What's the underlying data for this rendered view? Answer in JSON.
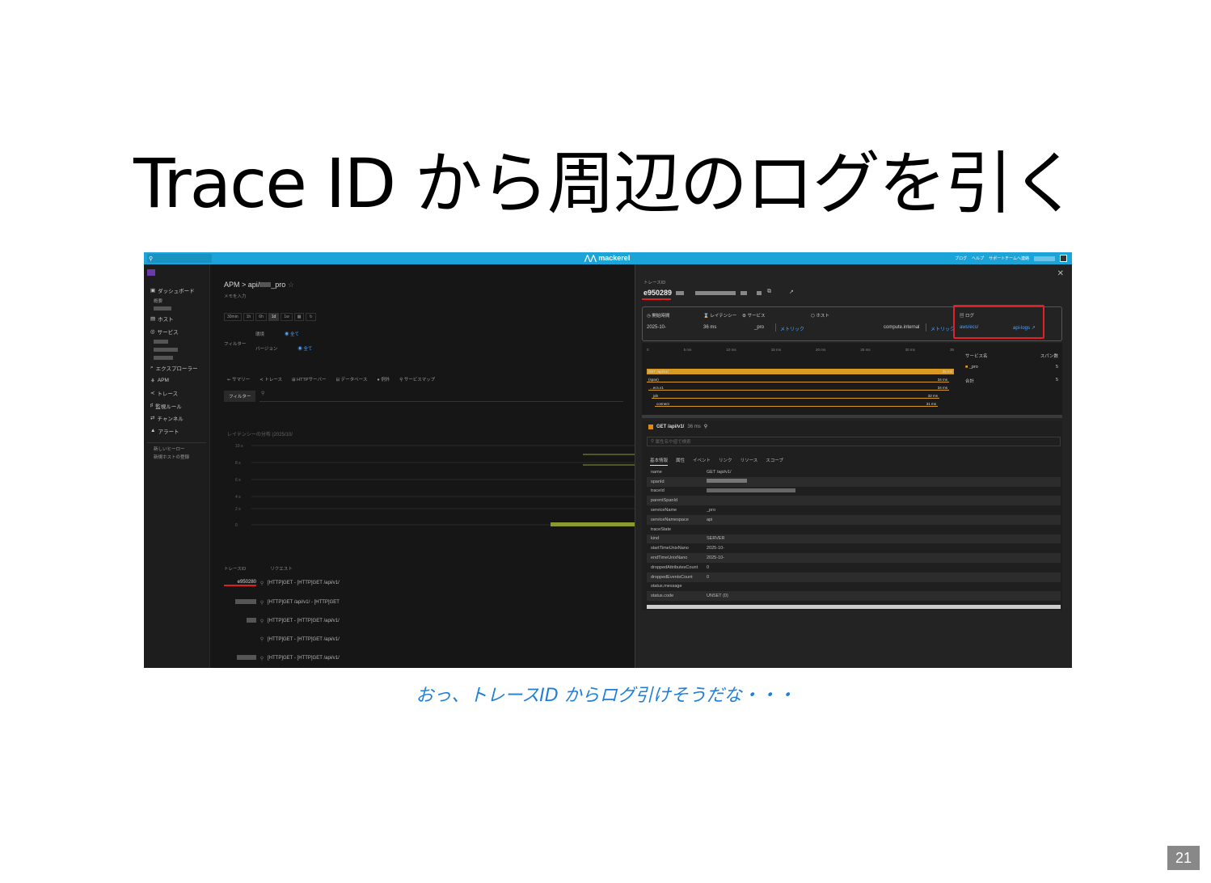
{
  "slide": {
    "title": "Trace ID から周辺のログを引く",
    "caption": "おっ、トレースID からログ引けそうだな・・・",
    "page_number": "21"
  },
  "app": {
    "search_icon": "search-icon",
    "logo": "mackerel",
    "topbar_links": [
      "ブログ",
      "ヘルプ",
      "サポートチームへ連絡"
    ]
  },
  "sidebar": {
    "items": [
      "ダッシュボード",
      "ホスト",
      "サービス",
      "エクスプローラー",
      "APM",
      "トレース",
      "監視ルール",
      "チャンネル",
      "アラート"
    ],
    "sub_first": "概要",
    "bottom_links": [
      "新しいヒーロー",
      "新規ホストの登録"
    ]
  },
  "main": {
    "breadcrumb": "APM > api/",
    "breadcrumb_suffix": "_pro",
    "breadcrumb_sub": "メモを入力",
    "time_buttons": [
      "30min",
      "1h",
      "6h",
      "1d",
      "1w"
    ],
    "filter_label": "フィルター",
    "filter_env": "環境",
    "filter_env_value": "全て",
    "filter_version": "バージョン",
    "filter_version_value": "全て",
    "tabs": [
      "サマリー",
      "トレース",
      "HTTPサーバー",
      "データベース",
      "例外",
      "サービスマップ"
    ],
    "filter_button": "フィルター",
    "chart_title": "レイテンシーの分布 (2025/10/",
    "chart_yticks": [
      "10 s",
      "8 s",
      "6 s",
      "4 s",
      "2 s",
      "0"
    ],
    "trace_headers": [
      "トレースID",
      "リクエスト"
    ],
    "trace_rows": [
      {
        "id": "e950280",
        "req": "[HTTP]GET - [HTTP]GET /api/v1/"
      },
      {
        "id": "",
        "req": "[HTTP]GET /api/v1/ - [HTTP]GET"
      },
      {
        "id": "",
        "req": "[HTTP]GET - [HTTP]GET /api/v1/"
      },
      {
        "id": "",
        "req": "[HTTP]GET - [HTTP]GET /api/v1/"
      },
      {
        "id": "",
        "req": "[HTTP]GET - [HTTP]GET /api/v1/"
      }
    ]
  },
  "panel": {
    "label": "トレースID",
    "trace_id": "e950289",
    "summary": {
      "start_label": "開始時間",
      "start_value": "2025-10-",
      "latency_label": "レイテンシー",
      "latency_value": "36 ms",
      "service_label": "サービス",
      "service_value": "_pro",
      "metric_link": "メトリック",
      "host_label": "ホスト",
      "host_value": "compute.internal",
      "host_metric_link": "メトリック",
      "log_label": "ログ",
      "log_link_1": "aws/ecs/",
      "log_link_2": "api-logs"
    },
    "waterfall_ticks": [
      "0",
      "5 ms",
      "10 ms",
      "15 ms",
      "20 ms",
      "25 ms",
      "30 ms",
      "35"
    ],
    "spans": [
      {
        "label": "GET /api/v1/",
        "dur": "36 ms"
      },
      {
        "label": "(span)",
        "dur": "34 ms"
      },
      {
        "label": "...ecs.v1",
        "dur": "34 ms"
      },
      {
        "label": "job",
        "dur": "32 ms"
      },
      {
        "label": "connect",
        "dur": "31 ms"
      }
    ],
    "service_table_head": [
      "サービス名",
      "スパン数"
    ],
    "service_rows": [
      {
        "name": "_pro",
        "count": "5"
      },
      {
        "name": "合計",
        "count": "5"
      }
    ],
    "span_title": "GET /api/v1/",
    "span_duration": "36 ms",
    "span_search_placeholder": "属性名や値で検索",
    "detail_tabs": [
      "基本情報",
      "属性",
      "イベント",
      "リンク",
      "リソース",
      "スコープ"
    ],
    "attributes": [
      {
        "key": "name",
        "value": "GET /api/v1/"
      },
      {
        "key": "spanId",
        "value": ""
      },
      {
        "key": "traceId",
        "value": ""
      },
      {
        "key": "parentSpanId",
        "value": ""
      },
      {
        "key": "serviceName",
        "value": "_pro"
      },
      {
        "key": "serviceNamespace",
        "value": "api"
      },
      {
        "key": "traceState",
        "value": ""
      },
      {
        "key": "kind",
        "value": "SERVER"
      },
      {
        "key": "startTimeUnixNano",
        "value": "2025-10-"
      },
      {
        "key": "endTimeUnixNano",
        "value": "2025-10-"
      },
      {
        "key": "droppedAttributesCount",
        "value": "0"
      },
      {
        "key": "droppedEventsCount",
        "value": "0"
      },
      {
        "key": "status.message",
        "value": ""
      },
      {
        "key": "status.code",
        "value": "UNSET (0)"
      }
    ]
  },
  "colors": {
    "accent": "#1ca4d8",
    "highlight": "#e0202a",
    "span_bar": "#e0a020",
    "caption": "#1f7fd8"
  }
}
